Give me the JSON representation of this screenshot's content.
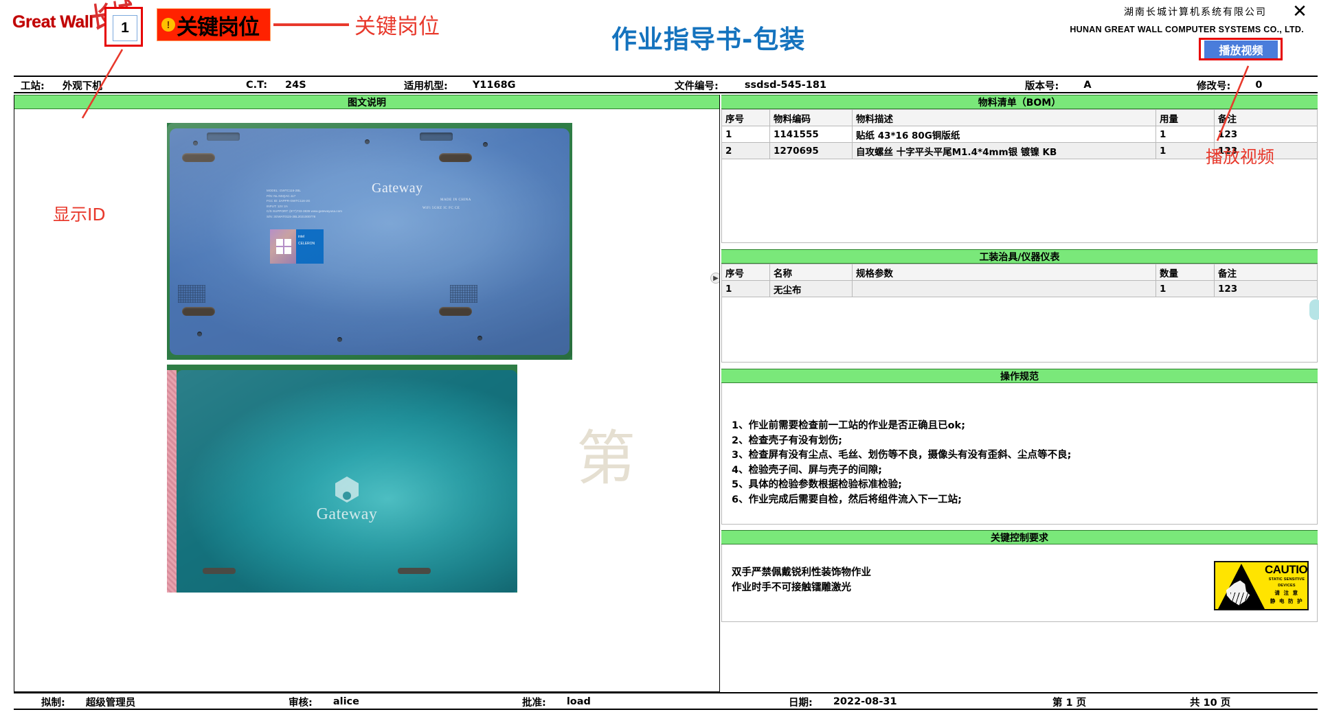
{
  "header": {
    "logo_text": "Great Wall",
    "logo_cn": "长城",
    "id_badge": "1",
    "key_post_badge": "关键岗位",
    "key_post_warn_icon": "exclamation-icon",
    "key_post_annotation": "关键岗位",
    "doc_title": "作业指导书-包装",
    "company_cn": "湖南长城计算机系统有限公司",
    "company_en": "HUNAN GREAT WALL COMPUTER SYSTEMS CO., LTD.",
    "close_icon": "close-icon",
    "play_video_button": "播放视频",
    "play_video_annotation": "播放视频"
  },
  "info_bar": {
    "station_label": "工站:",
    "station_value": "外观下机",
    "ct_label": "C.T:",
    "ct_value": "24S",
    "model_label": "适用机型:",
    "model_value": "Y1168G",
    "doc_no_label": "文件编号:",
    "doc_no_value": "ssdsd-545-181",
    "version_label": "版本号:",
    "version_value": "A",
    "revision_label": "修改号:",
    "revision_value": "0"
  },
  "left_panel": {
    "title": "图文说明",
    "show_id_annotation": "显示ID",
    "watermark": "第",
    "expand_icon": "chevron-right-icon",
    "photo1": {
      "name": "laptop-bottom-photo",
      "brand": "Gateway",
      "label_lines": [
        "MODEL: GWTC116-2BL",
        "P/N: NL.NSQAC.117",
        "FCC ID: 2APPR-GWTC116-2G",
        "INPUT: 12V 2A",
        "C/S SUPPORT: (877)733-3839   www.gatewayusa.com",
        "S/N: 3GWAT0115-2BL2021000778"
      ],
      "made_in": "MADE IN CHINA",
      "wifi_mark": "WiFi  5GHZ  IC  FC  CE",
      "cpu_sticker": "intel CELERON"
    },
    "photo2": {
      "name": "laptop-lid-photo",
      "brand": "Gateway"
    }
  },
  "bom": {
    "title": "物料清单（BOM）",
    "columns": [
      "序号",
      "物料编码",
      "物料描述",
      "用量",
      "备注"
    ],
    "rows": [
      [
        "1",
        "1141555",
        "贴纸 43*16 80G铜版纸",
        "1",
        "123"
      ],
      [
        "2",
        "1270695",
        "自攻螺丝 十字平头平尾M1.4*4mm银 镀镍 KB",
        "1",
        "123"
      ]
    ]
  },
  "tooling": {
    "title": "工装治具/仪器仪表",
    "columns": [
      "序号",
      "名称",
      "规格参数",
      "数量",
      "备注"
    ],
    "rows": [
      [
        "1",
        "无尘布",
        "",
        "1",
        "123"
      ]
    ]
  },
  "operations": {
    "title": "操作规范",
    "items": [
      "1、作业前需要检查前一工站的作业是否正确且已ok;",
      "2、检查壳子有没有划伤;",
      "3、检查屏有没有尘点、毛丝、划伤等不良，摄像头有没有歪斜、尘点等不良;",
      "4、检验壳子间、屏与壳子的间隙;",
      "5、具体的检验参数根据检验标准检验;",
      "6、作业完成后需要自检，然后将组件流入下一工站;"
    ]
  },
  "key_control": {
    "title": "关键控制要求",
    "lines": [
      "双手严禁佩戴锐利性装饰物作业",
      "作业时手不可接触镭雕激光"
    ],
    "caution": {
      "name": "esd-caution-sign",
      "headline": "CAUTION",
      "sub1": "STATIC SENSITIVE",
      "sub2": "DEVICES",
      "cn1": "请 注 意",
      "cn2": "静 电 防 护"
    }
  },
  "footer": {
    "prepared_label": "拟制:",
    "prepared_value": "超级管理员",
    "reviewed_label": "审核:",
    "reviewed_value": "alice",
    "approved_label": "批准:",
    "approved_value": "load",
    "date_label": "日期:",
    "date_value": "2022-08-31",
    "page_current": "第 1 页",
    "page_total": "共 10 页"
  },
  "colors": {
    "accent_green": "#7ae87a",
    "title_blue": "#1573be",
    "annotation_red": "#e8392c",
    "badge_red": "#ff2200",
    "button_blue": "#4a7ddb",
    "caution_yellow": "#ffe400"
  }
}
